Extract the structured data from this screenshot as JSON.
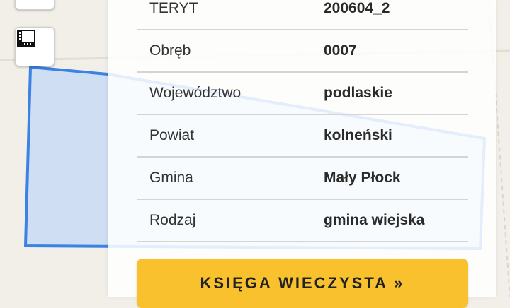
{
  "parcel_info": {
    "rows": [
      {
        "label": "TERYT",
        "value": "200604_2"
      },
      {
        "label": "Obręb",
        "value": "0007"
      },
      {
        "label": "Województwo",
        "value": "podlaskie"
      },
      {
        "label": "Powiat",
        "value": "kolneński"
      },
      {
        "label": "Gmina",
        "value": "Mały Płock"
      },
      {
        "label": "Rodzaj",
        "value": "gmina wiejska"
      }
    ]
  },
  "actions": {
    "land_register_label": "KSIĘGA WIECZYSTA »"
  },
  "map_controls": {
    "top_icon": "layers-icon",
    "measure_icon": "ruler-icon"
  },
  "colors": {
    "polygon_stroke": "#3b82e6",
    "polygon_fill": "#c9daf3",
    "button_accent": "#f9c12e",
    "map_background": "#f1efe8"
  }
}
